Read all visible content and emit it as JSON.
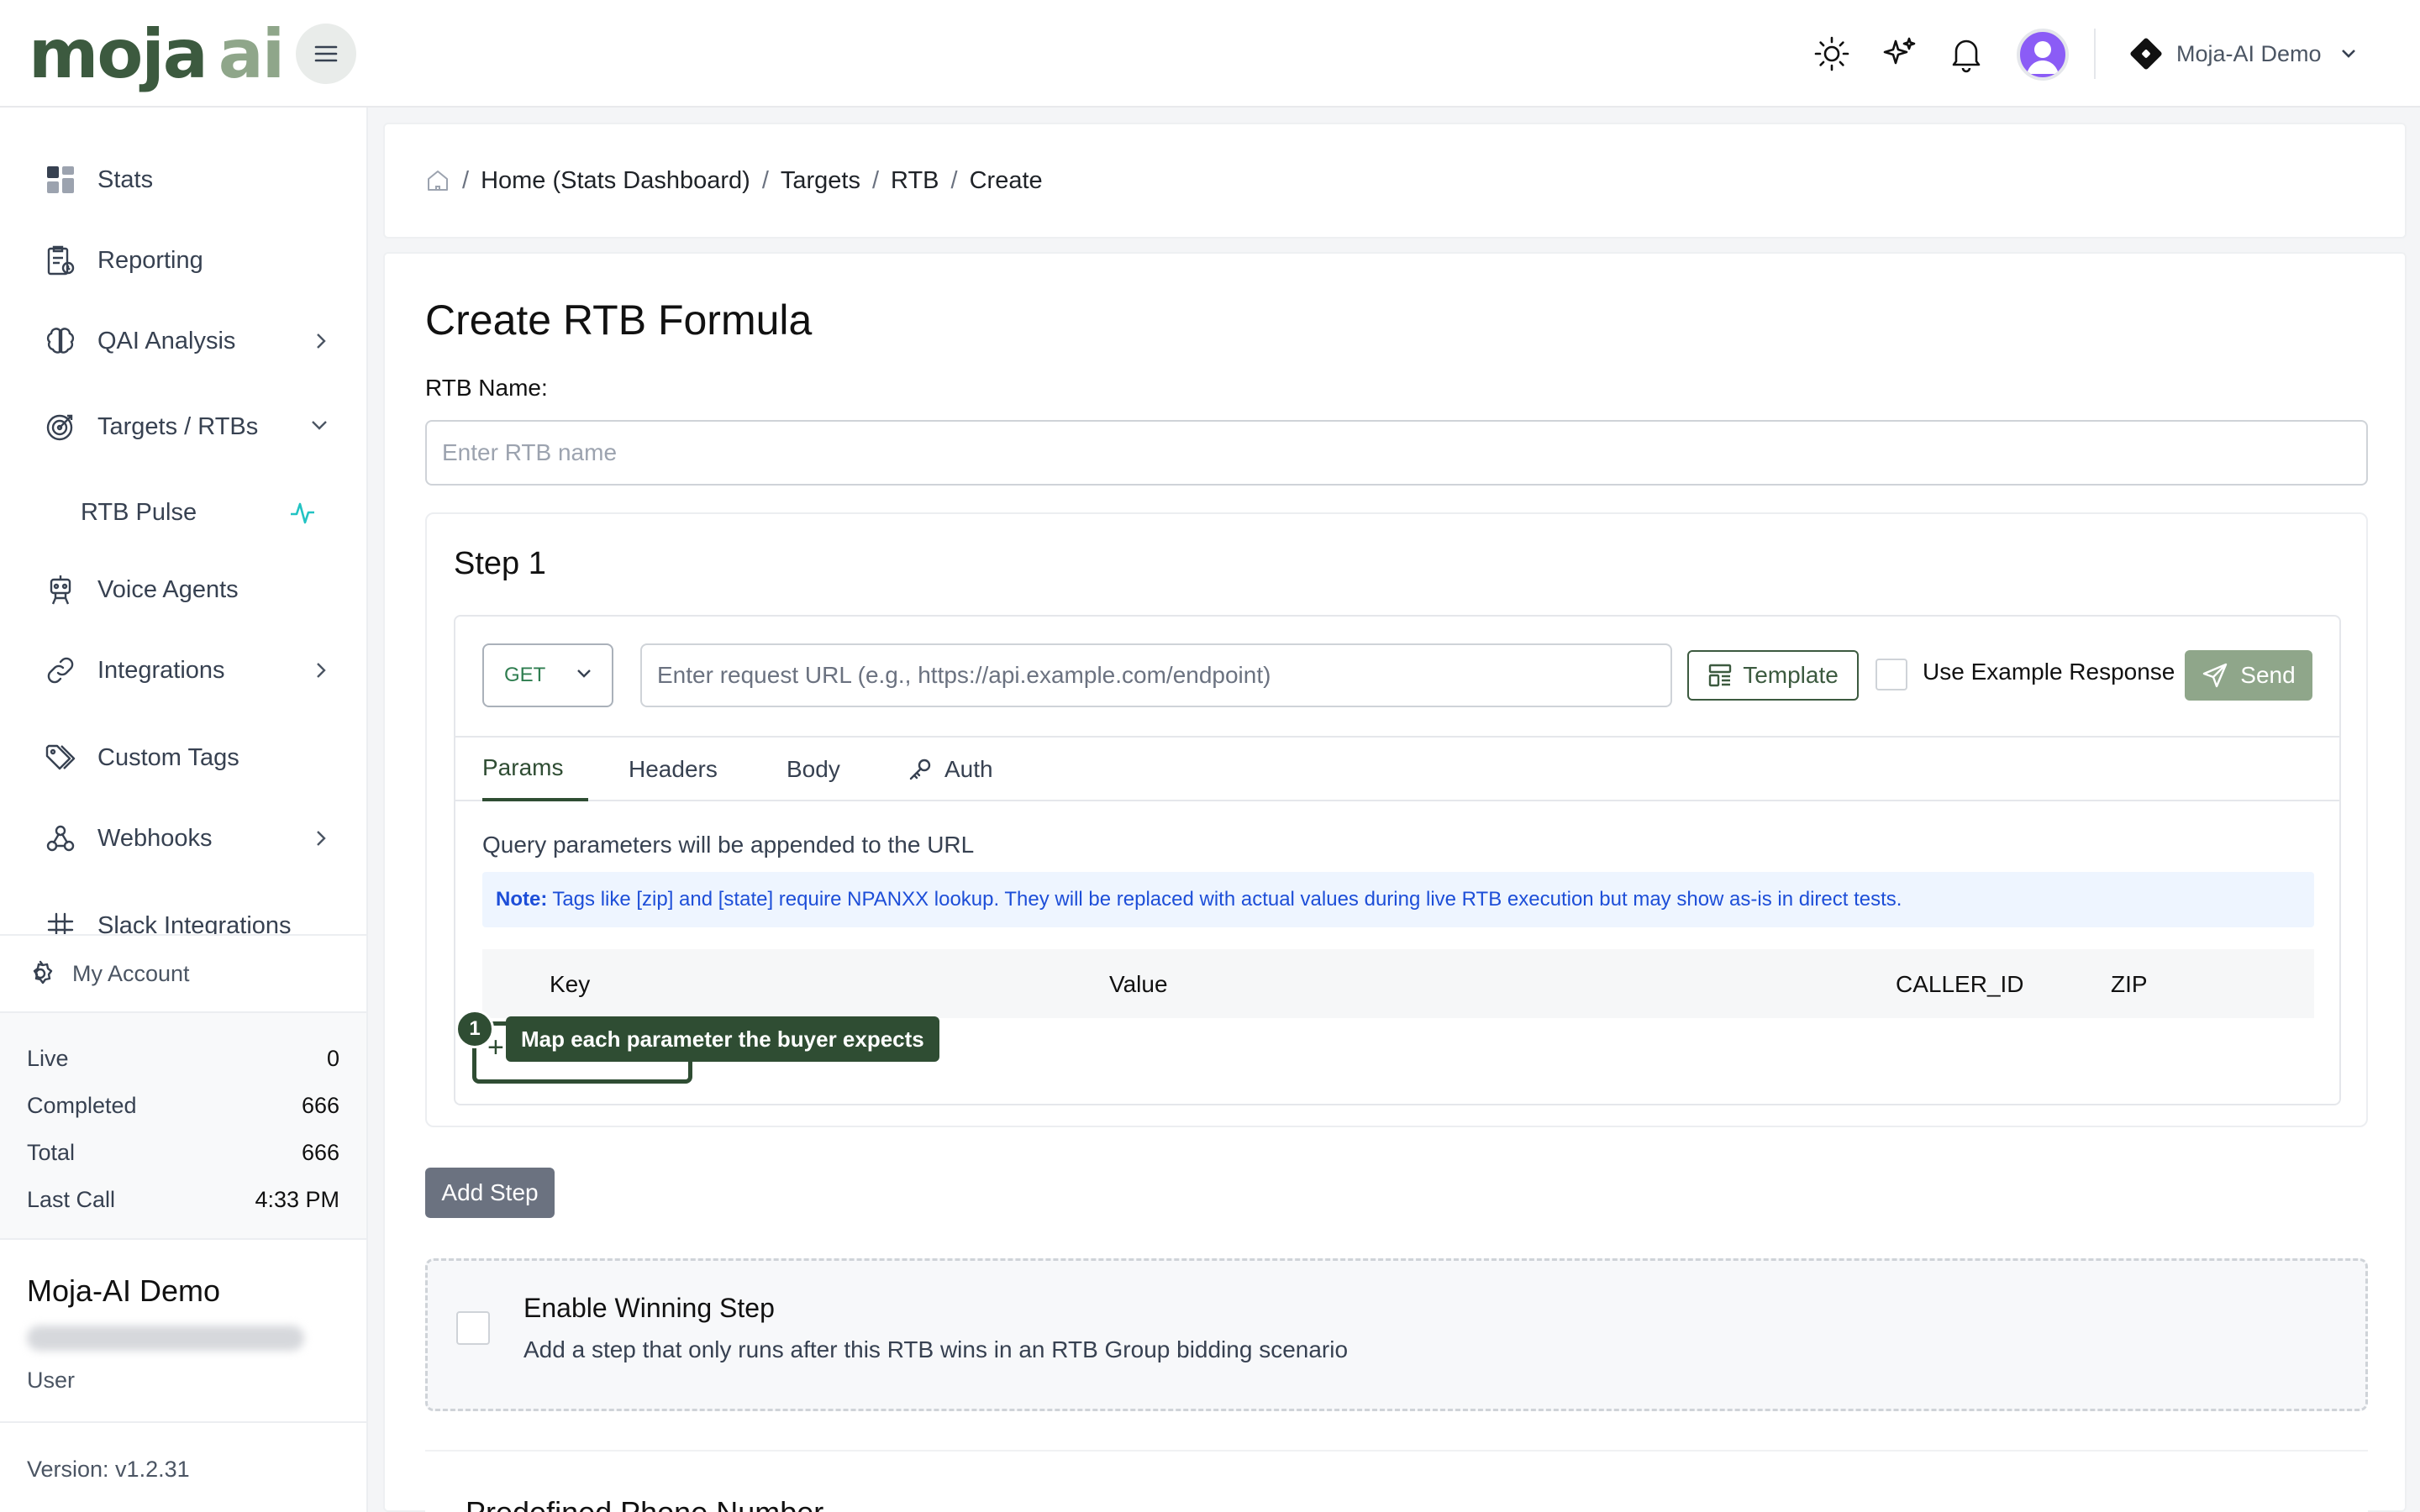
{
  "brand": {
    "logo_left": "moja",
    "logo_right": "ai"
  },
  "header": {
    "org_name": "Moja-AI Demo"
  },
  "sidebar": {
    "items": [
      {
        "label": "Stats"
      },
      {
        "label": "Reporting"
      },
      {
        "label": "QAI Analysis"
      },
      {
        "label": "Targets / RTBs"
      },
      {
        "label": "RTB Pulse"
      },
      {
        "label": "Voice Agents"
      },
      {
        "label": "Integrations"
      },
      {
        "label": "Custom Tags"
      },
      {
        "label": "Webhooks"
      },
      {
        "label": "Slack Integrations"
      }
    ],
    "account_label": "My Account",
    "stats": [
      {
        "label": "Live",
        "value": "0"
      },
      {
        "label": "Completed",
        "value": "666"
      },
      {
        "label": "Total",
        "value": "666"
      },
      {
        "label": "Last Call",
        "value": "4:33 PM"
      }
    ],
    "org": {
      "name": "Moja-AI Demo",
      "role": "User"
    },
    "version": "Version: v1.2.31"
  },
  "breadcrumb": {
    "items": [
      "Home (Stats Dashboard)",
      "Targets",
      "RTB",
      "Create"
    ],
    "separator": "/"
  },
  "form": {
    "title": "Create RTB Formula",
    "rtb_name_label": "RTB Name:",
    "rtb_name_placeholder": "Enter RTB name",
    "rtb_name_value": "",
    "step": {
      "title": "Step 1",
      "method": "GET",
      "url_placeholder": "Enter request URL (e.g., https://api.example.com/endpoint)",
      "template_label": "Template",
      "use_example_label": "Use Example Response",
      "send_label": "Send",
      "tabs": [
        "Params",
        "Headers",
        "Body",
        "Auth"
      ],
      "active_tab": "Params",
      "params_description": "Query parameters will be appended to the URL",
      "note_prefix": "Note:",
      "note_text": "Tags like [zip] and [state] require NPANXX lookup. They will be replaced with actual values during live RTB execution but may show as-is in direct tests.",
      "columns": [
        "Key",
        "Value",
        "CALLER_ID",
        "ZIP"
      ],
      "add_symbol": "+",
      "tour_step": "1",
      "tour_tooltip": "Map each parameter the buyer expects"
    },
    "add_step_label": "Add Step",
    "winning": {
      "title": "Enable Winning Step",
      "description": "Add a step that only runs after this RTB wins in an RTB Group bidding scenario"
    },
    "next_section_title": "Predefined Phone Number"
  },
  "colors": {
    "brand_dark": "#3c5a3f",
    "brand_light": "#8fa68a",
    "avatar": "#8b5cf6",
    "note_text": "#1d4ed8",
    "note_bg": "#eef5ff"
  }
}
